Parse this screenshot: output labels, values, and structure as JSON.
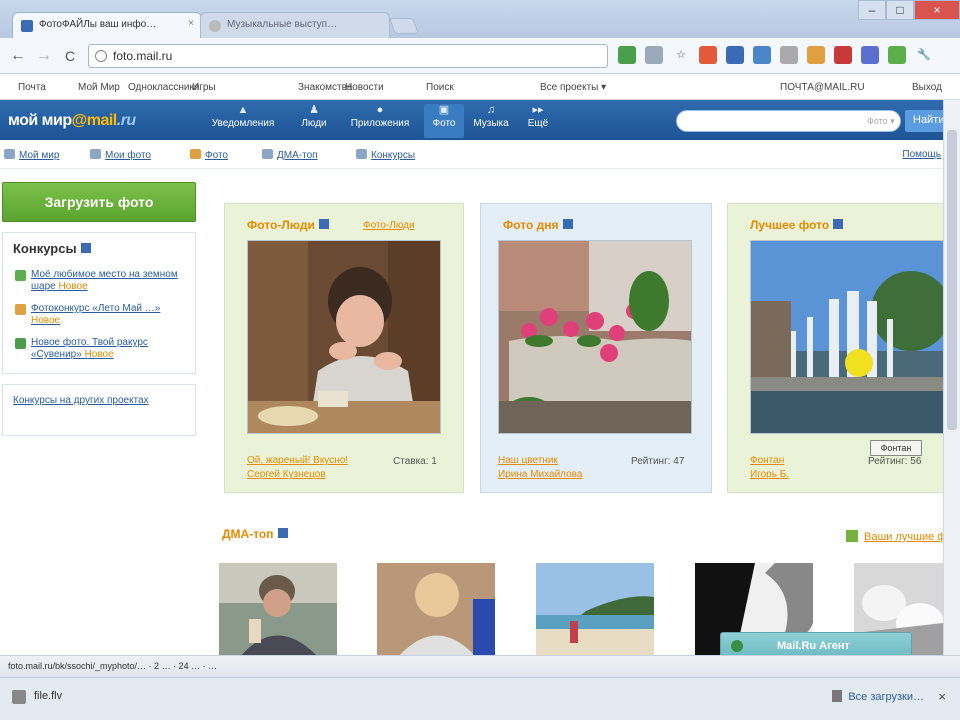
{
  "browser": {
    "tabs": [
      {
        "label": "ФотоФАЙЛы ваш инфо…",
        "close": "×"
      },
      {
        "label": "Музыкальные выступ…"
      }
    ],
    "window_buttons": {
      "minimize": "–",
      "maximize": "□",
      "close": "×"
    },
    "nav": {
      "back": "←",
      "forward": "→",
      "reload": "C"
    },
    "url": "foto.mail.ru",
    "extensions": [
      {
        "icon": "green-ext-icon",
        "color": "#4aa04a",
        "glyph": ""
      },
      {
        "icon": "page-ext-icon",
        "color": "#9aa9bb",
        "glyph": ""
      },
      {
        "icon": "star-icon",
        "color": "#f4f7fb",
        "glyph": "☆"
      },
      {
        "icon": "red-ext-icon",
        "color": "#e25a3a",
        "glyph": ""
      },
      {
        "icon": "agent-ext-icon",
        "color": "#3b6bb5",
        "glyph": ""
      },
      {
        "icon": "bird-ext-icon",
        "color": "#4a86c9",
        "glyph": ""
      },
      {
        "icon": "bar-ext-icon",
        "color": "#aaaaaa",
        "glyph": ""
      },
      {
        "icon": "orange-ext-icon",
        "color": "#e0a040",
        "glyph": ""
      },
      {
        "icon": "mail-ext-icon",
        "color": "#c83a3a",
        "glyph": ""
      },
      {
        "icon": "blue-ext-icon",
        "color": "#5a6fd0",
        "glyph": ""
      },
      {
        "icon": "green2-ext-icon",
        "color": "#5cae4a",
        "glyph": ""
      },
      {
        "icon": "wrench-icon",
        "color": "#f4f7fb",
        "glyph": "🔧"
      }
    ],
    "bookmarks": [
      "Почта",
      "Мой Мир",
      "Одноклассники",
      "Игры",
      "Знакомства",
      "Новости",
      "Поиск",
      "Все проекты ▾",
      "ПОЧТА@MAIL.RU",
      "Выход"
    ],
    "status_text": "foto.mail.ru/bk/ssochi/_myphoto/…  ·  2 …  ·  24 …  ·  …",
    "downloads": {
      "item": "file.flv",
      "all": "Все загрузки…",
      "close": "×"
    }
  },
  "site": {
    "brand": {
      "part1": "мой мир",
      "part2": "@mail",
      "part3": ".ru"
    },
    "nav": [
      {
        "label": "Уведомления",
        "icon": "bell-icon",
        "glyph": "▲"
      },
      {
        "label": "Люди",
        "icon": "people-icon",
        "glyph": "♟"
      },
      {
        "label": "Приложения",
        "icon": "apps-icon",
        "glyph": "●"
      },
      {
        "label": "Фото",
        "icon": "photo-icon",
        "glyph": "▣"
      },
      {
        "label": "Музыка",
        "icon": "music-icon",
        "glyph": "♫"
      },
      {
        "label": "Ещё",
        "icon": "more-icon",
        "glyph": "▸▸"
      }
    ],
    "search_placeholder": "Фото ▾",
    "search_button": "Найти",
    "subnav": [
      "Мой мир",
      "Мои фото",
      "Фото",
      "ДМА-топ",
      "Конкурсы"
    ],
    "subnav_right": "Помощь",
    "upload_button": "Загрузить фото",
    "contests": {
      "title": "Конкурсы",
      "items": [
        {
          "text": "Моё любимое место на земном шаре ",
          "highlight": "Новое",
          "color": "#5cae4a"
        },
        {
          "text": "Фотоконкурс «Лето Май …» ",
          "highlight": "Новое",
          "color": "#e0a040"
        },
        {
          "text": "Новое фото. Твой ракурс «Сувенир» ",
          "highlight": "Новое",
          "color": "#4a9d4a"
        }
      ],
      "link": "Конкурсы на других проектах"
    },
    "cards": [
      {
        "title": "Фото-Люди",
        "link": "Фото-Люди",
        "caption": "Ой, жареный! Вкусно!",
        "caption_sub": "Сергей Кузнецов",
        "meta": "Ставка: 1"
      },
      {
        "title": "Фото дня",
        "caption": "Наш цветник",
        "caption_sub": "Ирина Михайлова",
        "meta": "Рейтинг: 47"
      },
      {
        "title": "Лучшее фото",
        "caption": "Фонтан",
        "caption_sub": "Игорь Б.",
        "meta": "Рейтинг: 56",
        "badge": "Фонтан"
      }
    ],
    "dma": {
      "title": "ДМА-топ",
      "more": "Ваши лучшие фото"
    },
    "notification": "Mail.Ru Агент"
  }
}
